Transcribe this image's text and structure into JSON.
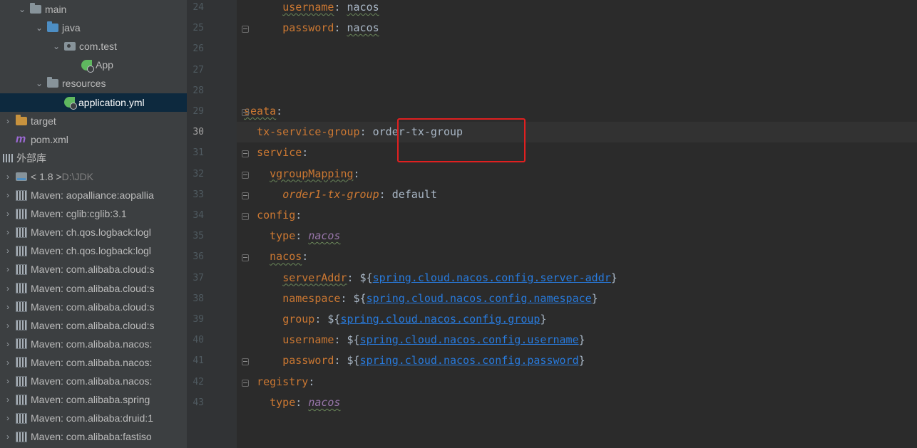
{
  "tree": [
    {
      "label": "main",
      "chevron": "v",
      "icon": "folder",
      "indent": 0
    },
    {
      "label": "java",
      "chevron": "v",
      "icon": "folder-blue",
      "indent": 1
    },
    {
      "label": "com.test",
      "chevron": "v",
      "icon": "package",
      "indent": 2
    },
    {
      "label": "App",
      "chevron": "",
      "icon": "spring-app",
      "indent": 3
    },
    {
      "label": "resources",
      "chevron": "v",
      "icon": "folder-res",
      "indent": 1
    },
    {
      "label": "application.yml",
      "chevron": "",
      "icon": "spring-yml",
      "indent": 2,
      "selected": true
    },
    {
      "label": "target",
      "chevron": ">",
      "icon": "folder-orange",
      "indent": -1
    },
    {
      "label": "pom.xml",
      "chevron": "",
      "icon": "maven",
      "indent": -1
    },
    {
      "label": "外部库",
      "chevron": "",
      "icon": "bars",
      "indent": -2
    },
    {
      "label": "< 1.8 > ",
      "extra": "D:\\JDK",
      "chevron": ">",
      "icon": "jdk",
      "indent": -1
    },
    {
      "label": "Maven: aopalliance:aopallia",
      "chevron": ">",
      "icon": "lib",
      "indent": -1
    },
    {
      "label": "Maven: cglib:cglib:3.1",
      "chevron": ">",
      "icon": "lib",
      "indent": -1
    },
    {
      "label": "Maven: ch.qos.logback:logl",
      "chevron": ">",
      "icon": "lib",
      "indent": -1
    },
    {
      "label": "Maven: ch.qos.logback:logl",
      "chevron": ">",
      "icon": "lib",
      "indent": -1
    },
    {
      "label": "Maven: com.alibaba.cloud:s",
      "chevron": ">",
      "icon": "lib",
      "indent": -1
    },
    {
      "label": "Maven: com.alibaba.cloud:s",
      "chevron": ">",
      "icon": "lib",
      "indent": -1
    },
    {
      "label": "Maven: com.alibaba.cloud:s",
      "chevron": ">",
      "icon": "lib",
      "indent": -1
    },
    {
      "label": "Maven: com.alibaba.cloud:s",
      "chevron": ">",
      "icon": "lib",
      "indent": -1
    },
    {
      "label": "Maven: com.alibaba.nacos:",
      "chevron": ">",
      "icon": "lib",
      "indent": -1
    },
    {
      "label": "Maven: com.alibaba.nacos:",
      "chevron": ">",
      "icon": "lib",
      "indent": -1
    },
    {
      "label": "Maven: com.alibaba.nacos:",
      "chevron": ">",
      "icon": "lib",
      "indent": -1
    },
    {
      "label": "Maven: com.alibaba.spring",
      "chevron": ">",
      "icon": "lib",
      "indent": -1
    },
    {
      "label": "Maven: com.alibaba:druid:1",
      "chevron": ">",
      "icon": "lib",
      "indent": -1
    },
    {
      "label": "Maven: com.alibaba:fastiso",
      "chevron": ">",
      "icon": "lib",
      "indent": -1
    }
  ],
  "editor": {
    "lines": [
      {
        "num": "24",
        "parts": [
          {
            "t": "      "
          },
          {
            "t": "username",
            "c": "key",
            "w": true
          },
          {
            "t": ": "
          },
          {
            "t": "nacos",
            "c": "val",
            "w": true
          }
        ]
      },
      {
        "num": "25",
        "parts": [
          {
            "t": "      "
          },
          {
            "t": "password",
            "c": "key"
          },
          {
            "t": ": "
          },
          {
            "t": "nacos",
            "c": "val",
            "w": true
          }
        ]
      },
      {
        "num": "26",
        "parts": []
      },
      {
        "num": "27",
        "parts": []
      },
      {
        "num": "28",
        "parts": []
      },
      {
        "num": "29",
        "parts": [
          {
            "t": "seata",
            "c": "key",
            "w": true
          },
          {
            "t": ":"
          }
        ]
      },
      {
        "num": "30",
        "current": true,
        "parts": [
          {
            "t": "  "
          },
          {
            "t": "tx-service-group",
            "c": "key"
          },
          {
            "t": ": "
          },
          {
            "t": "order-tx-group",
            "c": "val"
          }
        ]
      },
      {
        "num": "31",
        "parts": [
          {
            "t": "  "
          },
          {
            "t": "service",
            "c": "key"
          },
          {
            "t": ":"
          }
        ]
      },
      {
        "num": "32",
        "parts": [
          {
            "t": "    "
          },
          {
            "t": "vgroupMapping",
            "c": "key",
            "w": true
          },
          {
            "t": ":"
          }
        ]
      },
      {
        "num": "33",
        "parts": [
          {
            "t": "      "
          },
          {
            "t": "order1-tx-group",
            "c": "italic-key"
          },
          {
            "t": ": "
          },
          {
            "t": "default",
            "c": "val"
          }
        ]
      },
      {
        "num": "34",
        "parts": [
          {
            "t": "  "
          },
          {
            "t": "config",
            "c": "key"
          },
          {
            "t": ":"
          }
        ]
      },
      {
        "num": "35",
        "parts": [
          {
            "t": "    "
          },
          {
            "t": "type",
            "c": "key"
          },
          {
            "t": ": "
          },
          {
            "t": "nacos",
            "c": "enum",
            "w": true
          }
        ]
      },
      {
        "num": "36",
        "parts": [
          {
            "t": "    "
          },
          {
            "t": "nacos",
            "c": "key",
            "w": true
          },
          {
            "t": ":"
          }
        ]
      },
      {
        "num": "37",
        "parts": [
          {
            "t": "      "
          },
          {
            "t": "serverAddr",
            "c": "key",
            "w": true
          },
          {
            "t": ": ${"
          },
          {
            "t": "spring.cloud.nacos.config.server-addr",
            "c": "ref"
          },
          {
            "t": "}"
          }
        ]
      },
      {
        "num": "38",
        "parts": [
          {
            "t": "      "
          },
          {
            "t": "namespace",
            "c": "key"
          },
          {
            "t": ": ${"
          },
          {
            "t": "spring.cloud.nacos.config.namespace",
            "c": "ref"
          },
          {
            "t": "}"
          }
        ]
      },
      {
        "num": "39",
        "parts": [
          {
            "t": "      "
          },
          {
            "t": "group",
            "c": "key"
          },
          {
            "t": ": ${"
          },
          {
            "t": "spring.cloud.nacos.config.group",
            "c": "ref"
          },
          {
            "t": "}"
          }
        ]
      },
      {
        "num": "40",
        "parts": [
          {
            "t": "      "
          },
          {
            "t": "username",
            "c": "key"
          },
          {
            "t": ": ${"
          },
          {
            "t": "spring.cloud.nacos.config.username",
            "c": "ref"
          },
          {
            "t": "}"
          }
        ]
      },
      {
        "num": "41",
        "parts": [
          {
            "t": "      "
          },
          {
            "t": "password",
            "c": "key"
          },
          {
            "t": ": ${"
          },
          {
            "t": "spring.cloud.nacos.config.password",
            "c": "ref"
          },
          {
            "t": "}"
          }
        ]
      },
      {
        "num": "42",
        "parts": [
          {
            "t": "  "
          },
          {
            "t": "registry",
            "c": "key"
          },
          {
            "t": ":"
          }
        ]
      },
      {
        "num": "43",
        "parts": [
          {
            "t": "    "
          },
          {
            "t": "type",
            "c": "key"
          },
          {
            "t": ": "
          },
          {
            "t": "nacos",
            "c": "enum",
            "w": true
          }
        ]
      }
    ]
  },
  "colors": {
    "key": "#cc7832",
    "value": "#a9b7c6",
    "enum": "#9876aa",
    "link": "#287bde",
    "highlight": "#e02020"
  }
}
